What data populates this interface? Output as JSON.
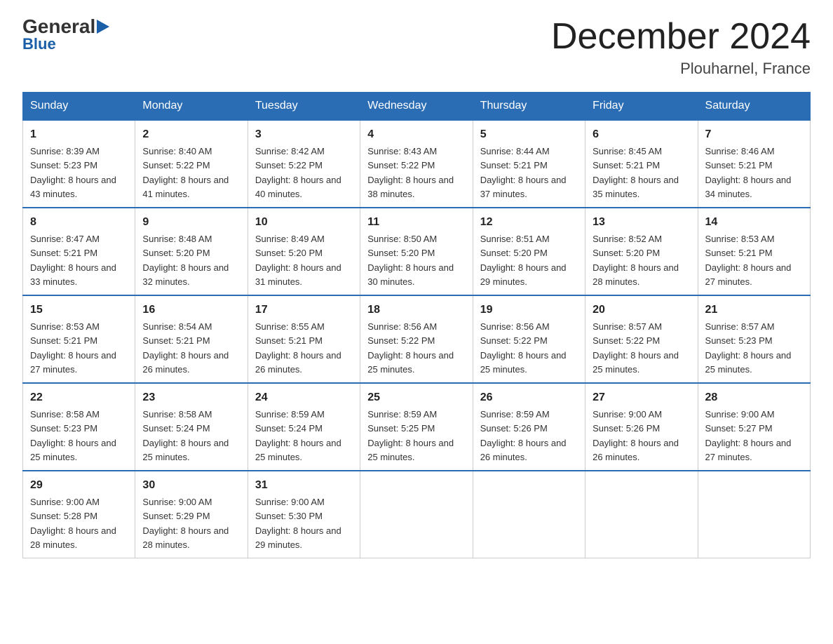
{
  "logo": {
    "general": "General",
    "blue": "Blue",
    "arrow": "▶"
  },
  "title": "December 2024",
  "subtitle": "Plouharnel, France",
  "headers": [
    "Sunday",
    "Monday",
    "Tuesday",
    "Wednesday",
    "Thursday",
    "Friday",
    "Saturday"
  ],
  "weeks": [
    [
      {
        "day": "1",
        "sunrise": "8:39 AM",
        "sunset": "5:23 PM",
        "daylight": "8 hours and 43 minutes."
      },
      {
        "day": "2",
        "sunrise": "8:40 AM",
        "sunset": "5:22 PM",
        "daylight": "8 hours and 41 minutes."
      },
      {
        "day": "3",
        "sunrise": "8:42 AM",
        "sunset": "5:22 PM",
        "daylight": "8 hours and 40 minutes."
      },
      {
        "day": "4",
        "sunrise": "8:43 AM",
        "sunset": "5:22 PM",
        "daylight": "8 hours and 38 minutes."
      },
      {
        "day": "5",
        "sunrise": "8:44 AM",
        "sunset": "5:21 PM",
        "daylight": "8 hours and 37 minutes."
      },
      {
        "day": "6",
        "sunrise": "8:45 AM",
        "sunset": "5:21 PM",
        "daylight": "8 hours and 35 minutes."
      },
      {
        "day": "7",
        "sunrise": "8:46 AM",
        "sunset": "5:21 PM",
        "daylight": "8 hours and 34 minutes."
      }
    ],
    [
      {
        "day": "8",
        "sunrise": "8:47 AM",
        "sunset": "5:21 PM",
        "daylight": "8 hours and 33 minutes."
      },
      {
        "day": "9",
        "sunrise": "8:48 AM",
        "sunset": "5:20 PM",
        "daylight": "8 hours and 32 minutes."
      },
      {
        "day": "10",
        "sunrise": "8:49 AM",
        "sunset": "5:20 PM",
        "daylight": "8 hours and 31 minutes."
      },
      {
        "day": "11",
        "sunrise": "8:50 AM",
        "sunset": "5:20 PM",
        "daylight": "8 hours and 30 minutes."
      },
      {
        "day": "12",
        "sunrise": "8:51 AM",
        "sunset": "5:20 PM",
        "daylight": "8 hours and 29 minutes."
      },
      {
        "day": "13",
        "sunrise": "8:52 AM",
        "sunset": "5:20 PM",
        "daylight": "8 hours and 28 minutes."
      },
      {
        "day": "14",
        "sunrise": "8:53 AM",
        "sunset": "5:21 PM",
        "daylight": "8 hours and 27 minutes."
      }
    ],
    [
      {
        "day": "15",
        "sunrise": "8:53 AM",
        "sunset": "5:21 PM",
        "daylight": "8 hours and 27 minutes."
      },
      {
        "day": "16",
        "sunrise": "8:54 AM",
        "sunset": "5:21 PM",
        "daylight": "8 hours and 26 minutes."
      },
      {
        "day": "17",
        "sunrise": "8:55 AM",
        "sunset": "5:21 PM",
        "daylight": "8 hours and 26 minutes."
      },
      {
        "day": "18",
        "sunrise": "8:56 AM",
        "sunset": "5:22 PM",
        "daylight": "8 hours and 25 minutes."
      },
      {
        "day": "19",
        "sunrise": "8:56 AM",
        "sunset": "5:22 PM",
        "daylight": "8 hours and 25 minutes."
      },
      {
        "day": "20",
        "sunrise": "8:57 AM",
        "sunset": "5:22 PM",
        "daylight": "8 hours and 25 minutes."
      },
      {
        "day": "21",
        "sunrise": "8:57 AM",
        "sunset": "5:23 PM",
        "daylight": "8 hours and 25 minutes."
      }
    ],
    [
      {
        "day": "22",
        "sunrise": "8:58 AM",
        "sunset": "5:23 PM",
        "daylight": "8 hours and 25 minutes."
      },
      {
        "day": "23",
        "sunrise": "8:58 AM",
        "sunset": "5:24 PM",
        "daylight": "8 hours and 25 minutes."
      },
      {
        "day": "24",
        "sunrise": "8:59 AM",
        "sunset": "5:24 PM",
        "daylight": "8 hours and 25 minutes."
      },
      {
        "day": "25",
        "sunrise": "8:59 AM",
        "sunset": "5:25 PM",
        "daylight": "8 hours and 25 minutes."
      },
      {
        "day": "26",
        "sunrise": "8:59 AM",
        "sunset": "5:26 PM",
        "daylight": "8 hours and 26 minutes."
      },
      {
        "day": "27",
        "sunrise": "9:00 AM",
        "sunset": "5:26 PM",
        "daylight": "8 hours and 26 minutes."
      },
      {
        "day": "28",
        "sunrise": "9:00 AM",
        "sunset": "5:27 PM",
        "daylight": "8 hours and 27 minutes."
      }
    ],
    [
      {
        "day": "29",
        "sunrise": "9:00 AM",
        "sunset": "5:28 PM",
        "daylight": "8 hours and 28 minutes."
      },
      {
        "day": "30",
        "sunrise": "9:00 AM",
        "sunset": "5:29 PM",
        "daylight": "8 hours and 28 minutes."
      },
      {
        "day": "31",
        "sunrise": "9:00 AM",
        "sunset": "5:30 PM",
        "daylight": "8 hours and 29 minutes."
      },
      null,
      null,
      null,
      null
    ]
  ]
}
